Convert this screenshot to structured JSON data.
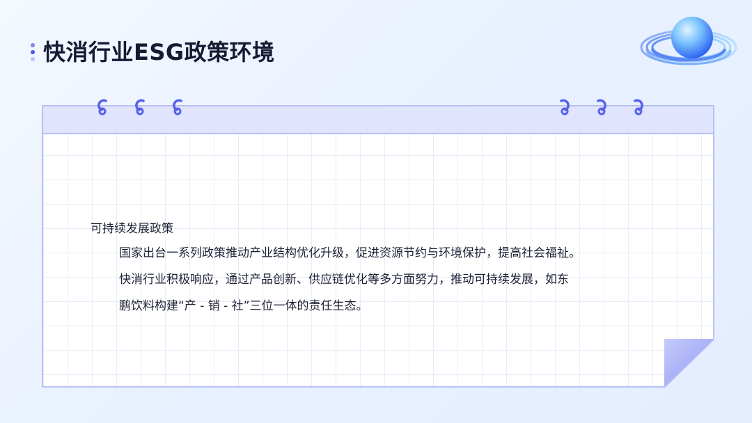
{
  "slide": {
    "title": "快消行业ESG政策环境",
    "section": {
      "heading": "可持续发展政策",
      "lines": [
        "国家出台一系列政策推动产业结构优化升级，促进资源节约与环境保护，提高社会福祉。",
        "快消行业积极响应，通过产品创新、供应链优化等多方面努力，推动可持续发展，如东",
        "鹏饮料构建“产 - 销 - 社”三位一体的责任生态。"
      ]
    }
  },
  "icons": {
    "logo": "planet-ring-icon",
    "binder": "binder-ring-icon",
    "bullets": "title-dots-icon"
  },
  "colors": {
    "accent": "#4b55e8",
    "card_border": "#b8bff5",
    "header_fill": "#e0e4fc",
    "text": "#1e2235"
  }
}
